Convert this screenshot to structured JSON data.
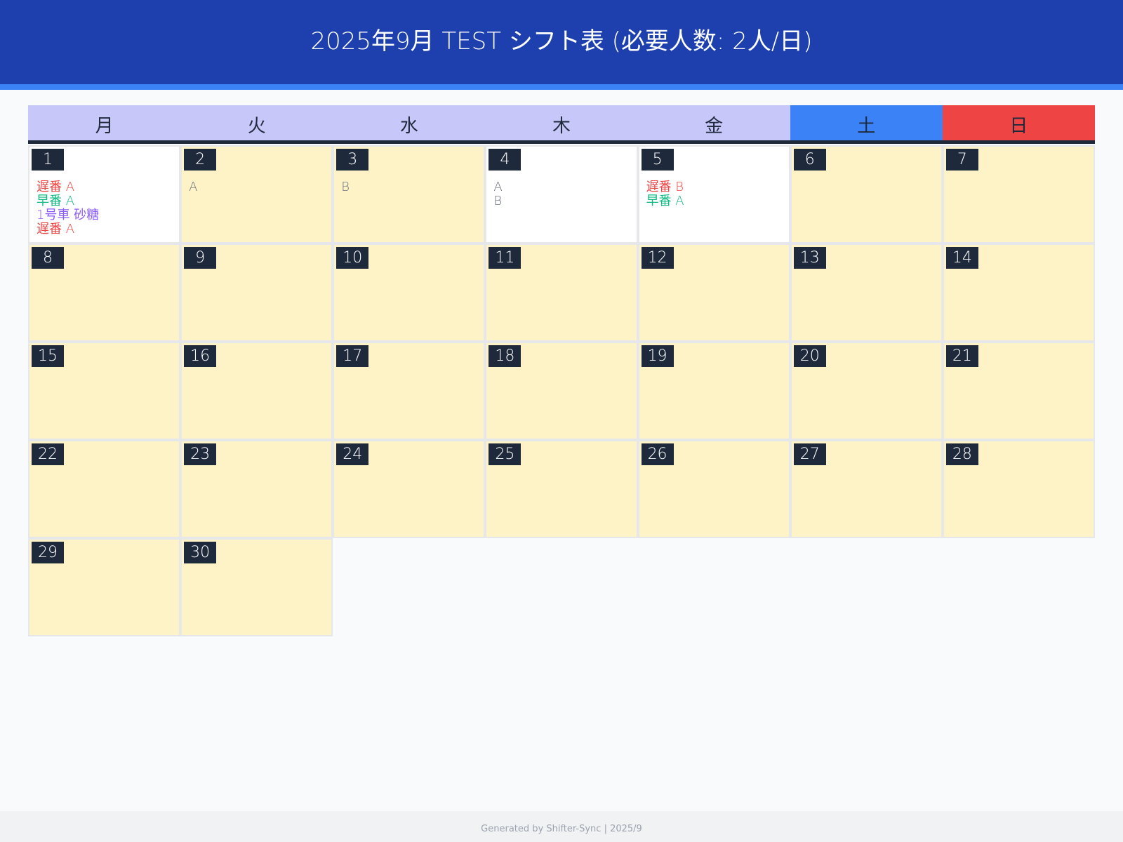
{
  "header": {
    "title": "2025年9月 TEST シフト表 (必要人数: 2人/日)"
  },
  "weekdays": [
    {
      "label": "月",
      "type": "weekday"
    },
    {
      "label": "火",
      "type": "weekday"
    },
    {
      "label": "水",
      "type": "weekday"
    },
    {
      "label": "木",
      "type": "weekday"
    },
    {
      "label": "金",
      "type": "weekday"
    },
    {
      "label": "土",
      "type": "sat"
    },
    {
      "label": "日",
      "type": "sun"
    }
  ],
  "colors": {
    "header_bg": "#1e40af",
    "header_border": "#3b82f6",
    "weekday_bg": "#c7c7f9",
    "saturday_bg": "#3b82f6",
    "sunday_bg": "#ef4444",
    "understaffed_cell": "#fef3c7",
    "staffed_cell": "#ffffff",
    "late_shift": "#ef4444",
    "early_shift": "#10b981",
    "vehicle": "#8b5cf6",
    "plain": "#6b7280"
  },
  "days": [
    {
      "day": "1",
      "filled": true,
      "entries": [
        {
          "text": "遅番 A",
          "color": "#ef4444"
        },
        {
          "text": "早番 A",
          "color": "#10b981"
        },
        {
          "text": "1号車 砂糖",
          "color": "#8b5cf6"
        },
        {
          "text": "遅番 A",
          "color": "#ef4444"
        }
      ]
    },
    {
      "day": "2",
      "filled": false,
      "entries": [
        {
          "text": "A",
          "color": "#6b7280"
        }
      ]
    },
    {
      "day": "3",
      "filled": false,
      "entries": [
        {
          "text": "B",
          "color": "#6b7280"
        }
      ]
    },
    {
      "day": "4",
      "filled": true,
      "entries": [
        {
          "text": "A",
          "color": "#6b7280"
        },
        {
          "text": "B",
          "color": "#6b7280"
        }
      ]
    },
    {
      "day": "5",
      "filled": true,
      "entries": [
        {
          "text": "遅番 B",
          "color": "#ef4444"
        },
        {
          "text": "早番 A",
          "color": "#10b981"
        }
      ]
    },
    {
      "day": "6",
      "filled": false,
      "entries": []
    },
    {
      "day": "7",
      "filled": false,
      "entries": []
    },
    {
      "day": "8",
      "filled": false,
      "entries": []
    },
    {
      "day": "9",
      "filled": false,
      "entries": []
    },
    {
      "day": "10",
      "filled": false,
      "entries": []
    },
    {
      "day": "11",
      "filled": false,
      "entries": []
    },
    {
      "day": "12",
      "filled": false,
      "entries": []
    },
    {
      "day": "13",
      "filled": false,
      "entries": []
    },
    {
      "day": "14",
      "filled": false,
      "entries": []
    },
    {
      "day": "15",
      "filled": false,
      "entries": []
    },
    {
      "day": "16",
      "filled": false,
      "entries": []
    },
    {
      "day": "17",
      "filled": false,
      "entries": []
    },
    {
      "day": "18",
      "filled": false,
      "entries": []
    },
    {
      "day": "19",
      "filled": false,
      "entries": []
    },
    {
      "day": "20",
      "filled": false,
      "entries": []
    },
    {
      "day": "21",
      "filled": false,
      "entries": []
    },
    {
      "day": "22",
      "filled": false,
      "entries": []
    },
    {
      "day": "23",
      "filled": false,
      "entries": []
    },
    {
      "day": "24",
      "filled": false,
      "entries": []
    },
    {
      "day": "25",
      "filled": false,
      "entries": []
    },
    {
      "day": "26",
      "filled": false,
      "entries": []
    },
    {
      "day": "27",
      "filled": false,
      "entries": []
    },
    {
      "day": "28",
      "filled": false,
      "entries": []
    },
    {
      "day": "29",
      "filled": false,
      "entries": []
    },
    {
      "day": "30",
      "filled": false,
      "entries": []
    }
  ],
  "footer": {
    "text": "Generated by Shifter-Sync | 2025/9"
  }
}
